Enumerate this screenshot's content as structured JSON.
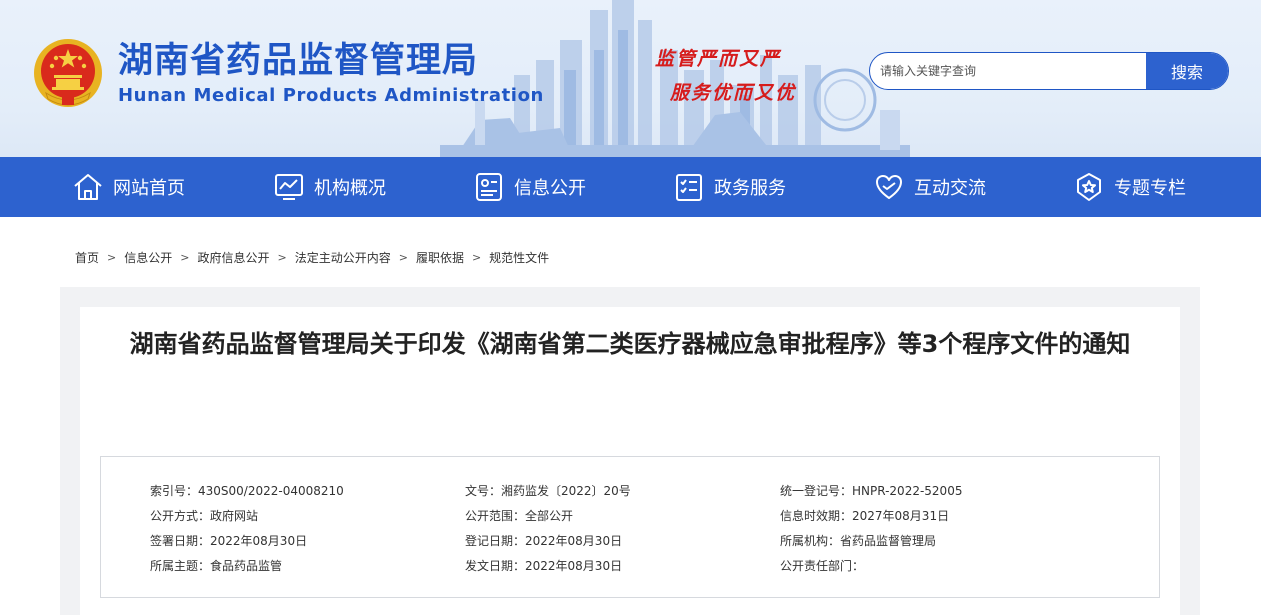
{
  "header": {
    "title": "湖南省药品监督管理局",
    "subtitle": "Hunan Medical Products Administration",
    "slogan_line1": "监管严而又严",
    "slogan_line2": "服务优而又优"
  },
  "search": {
    "placeholder": "请输入关键字查询",
    "value": "",
    "button_label": "搜索"
  },
  "nav": {
    "items": [
      {
        "label": "网站首页",
        "icon": "home-icon"
      },
      {
        "label": "机构概况",
        "icon": "chart-monitor-icon"
      },
      {
        "label": "信息公开",
        "icon": "id-card-icon"
      },
      {
        "label": "政务服务",
        "icon": "checklist-icon"
      },
      {
        "label": "互动交流",
        "icon": "heart-hand-icon"
      },
      {
        "label": "专题专栏",
        "icon": "star-badge-icon"
      }
    ]
  },
  "breadcrumb": [
    "首页",
    "信息公开",
    "政府信息公开",
    "法定主动公开内容",
    "履职依据",
    "规范性文件"
  ],
  "article": {
    "title": "湖南省药品监督管理局关于印发《湖南省第二类医疗器械应急审批程序》等3个程序文件的通知"
  },
  "meta": {
    "rows": [
      [
        "索引号：430S00/2022-04008210",
        "文号：湘药监发〔2022〕20号",
        "统一登记号：HNPR-2022-52005"
      ],
      [
        "公开方式：政府网站",
        "公开范围：全部公开",
        "信息时效期：2027年08月31日"
      ],
      [
        "签署日期：2022年08月30日",
        "登记日期：2022年08月30日",
        "所属机构：省药品监督管理局"
      ],
      [
        "所属主题：食品药品监管",
        "发文日期：2022年08月30日",
        "公开责任部门："
      ]
    ]
  },
  "colors": {
    "brand_blue": "#2d62cf",
    "title_blue": "#1f56c5",
    "slogan_red": "#d61c1c"
  }
}
